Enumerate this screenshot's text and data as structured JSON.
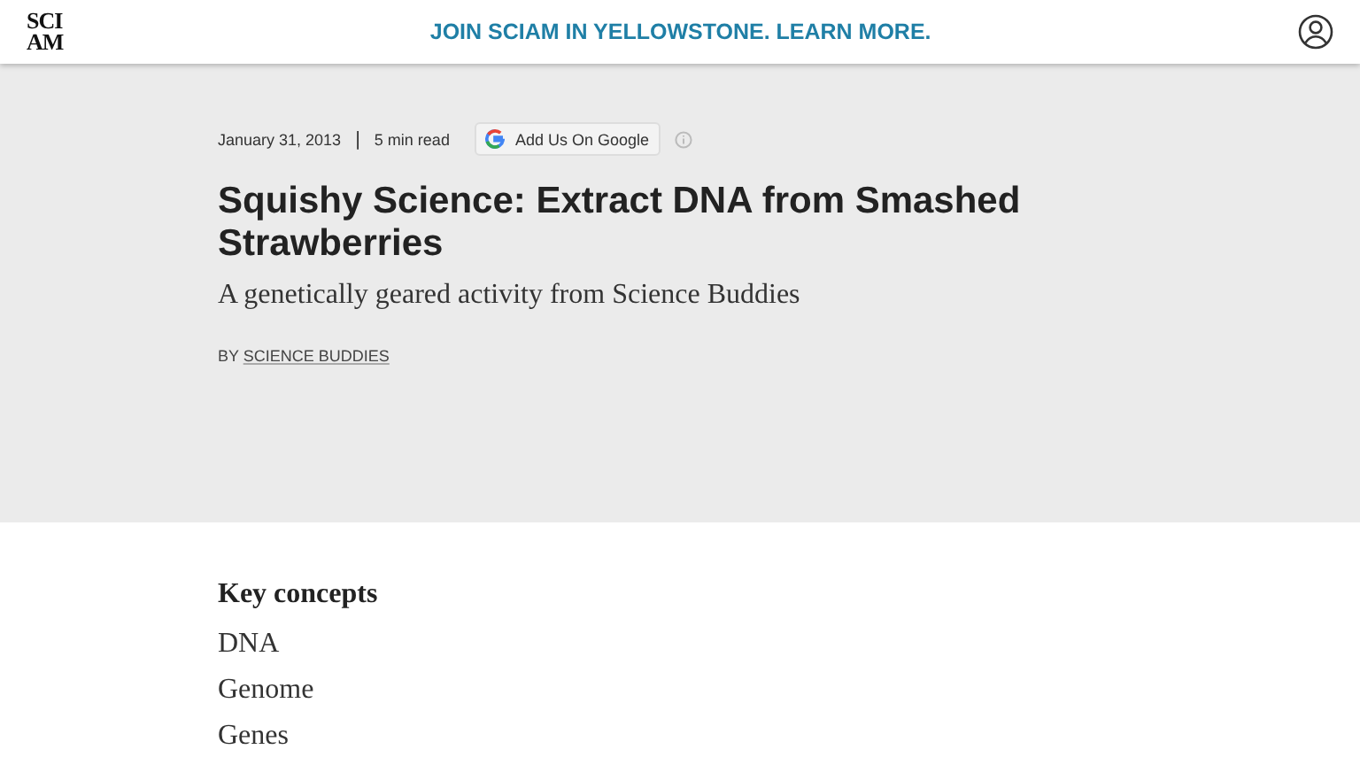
{
  "header": {
    "logo_lines": [
      "SCI",
      "AM"
    ],
    "promo_link": "JOIN SCIAM IN YELLOWSTONE. LEARN MORE."
  },
  "article": {
    "date": "January 31, 2013",
    "separator": "|",
    "read_time": "5 min read",
    "google_button": "Add Us On Google",
    "title": "Squishy Science: Extract DNA from Smashed Strawberries",
    "subtitle": "A genetically geared activity from Science Buddies",
    "byline_prefix": "BY",
    "author": "SCIENCE BUDDIES"
  },
  "key_concepts": {
    "heading": "Key concepts",
    "items": [
      "DNA",
      "Genome",
      "Genes"
    ]
  }
}
